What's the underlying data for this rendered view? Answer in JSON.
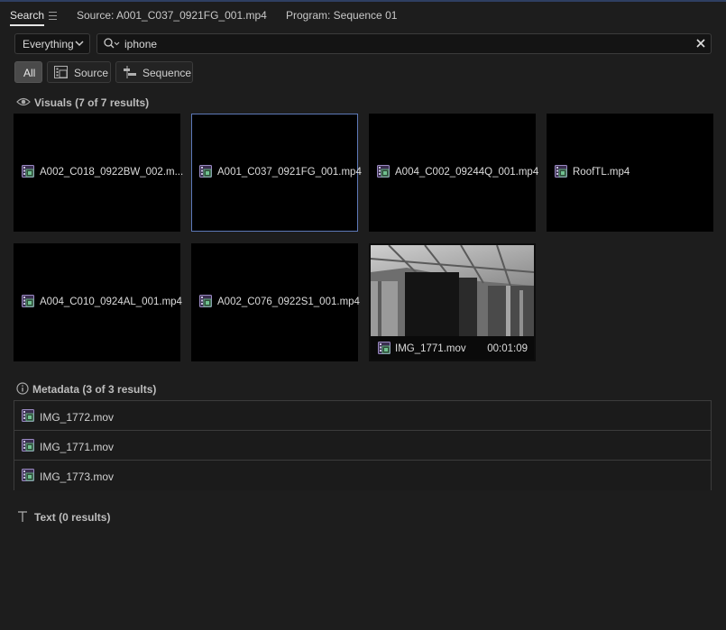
{
  "tabs": {
    "search": "Search",
    "source": "Source: A001_C037_0921FG_001.mp4",
    "program": "Program: Sequence 01"
  },
  "scope": {
    "selected": "Everything"
  },
  "search": {
    "query": "iphone"
  },
  "filters": {
    "all": "All",
    "source": "Source",
    "sequence": "Sequence"
  },
  "visuals": {
    "header": "Visuals (7 of 7 results)",
    "items": [
      {
        "name": "A002_C018_0922BW_002.m..."
      },
      {
        "name": "A001_C037_0921FG_001.mp4"
      },
      {
        "name": "A004_C002_09244Q_001.mp4"
      },
      {
        "name": "RoofTL.mp4"
      },
      {
        "name": "A004_C010_0924AL_001.mp4"
      },
      {
        "name": "A002_C076_0922S1_001.mp4"
      },
      {
        "name": "IMG_1771.mov",
        "duration": "00:01:09"
      }
    ]
  },
  "metadata": {
    "header": "Metadata (3 of 3 results)",
    "items": [
      {
        "name": "IMG_1772.mov"
      },
      {
        "name": "IMG_1771.mov"
      },
      {
        "name": "IMG_1773.mov"
      }
    ]
  },
  "text_section": {
    "header": "Text (0 results)"
  },
  "colors": {
    "accent": "#5d79b8",
    "background": "#1d1d1d",
    "tile": "#000000"
  }
}
